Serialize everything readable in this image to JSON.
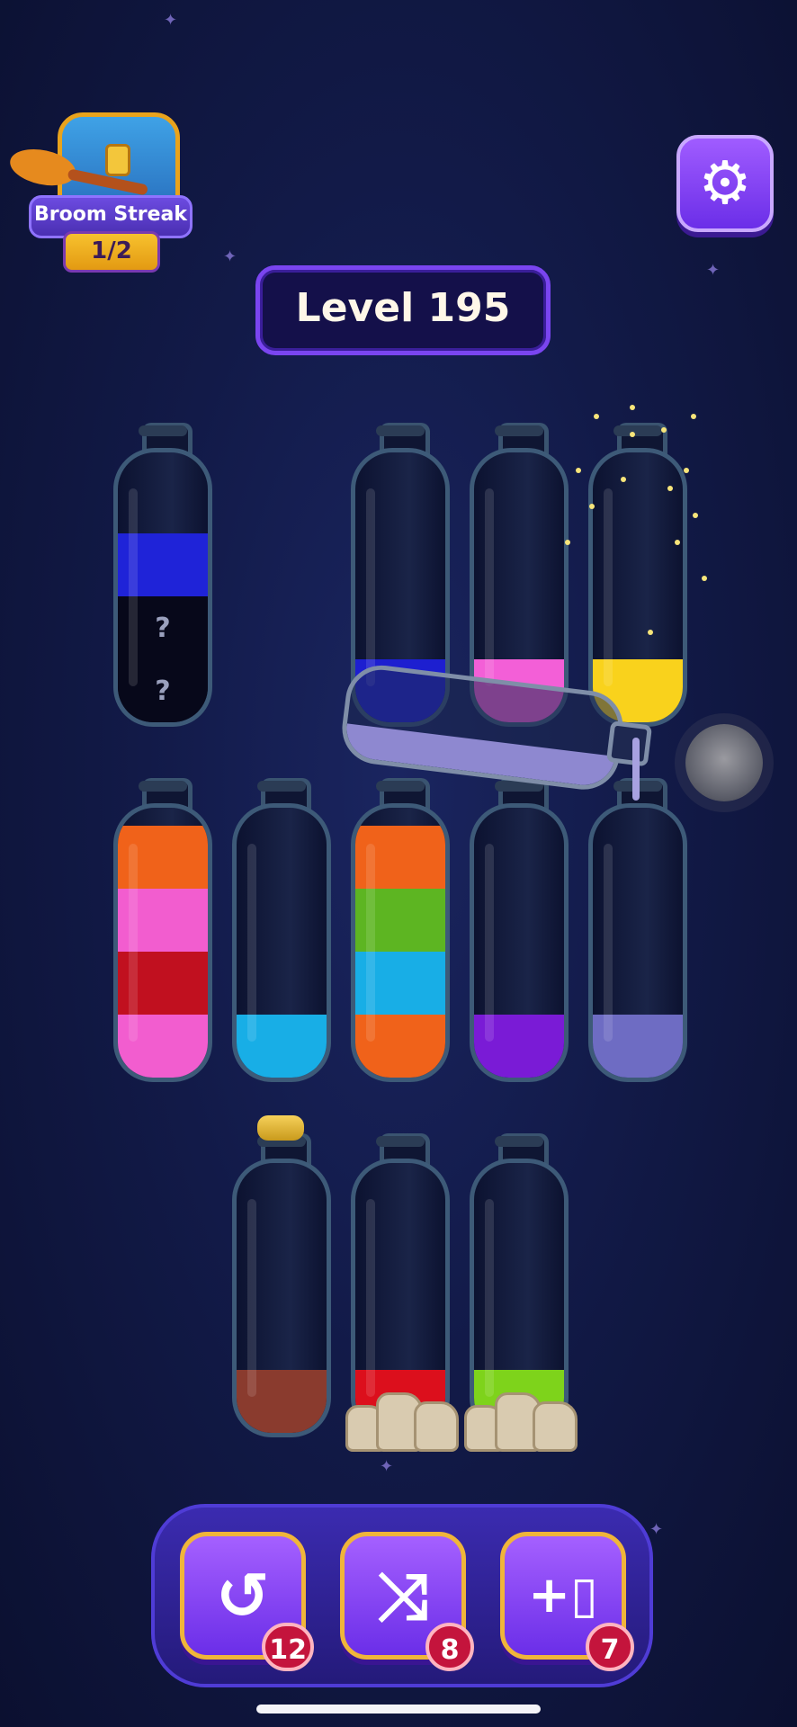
{
  "streak": {
    "title": "Broom Streak",
    "progress": "1/2"
  },
  "level": {
    "label": "Level 195"
  },
  "bottles": [
    {
      "id": "b1",
      "layers": [
        "#1f23d8",
        "hidden",
        "hidden"
      ],
      "hidden_mark": "?"
    },
    {
      "id": "b2",
      "layers": [
        "#1d1fd0"
      ]
    },
    {
      "id": "b3",
      "layers": [
        "#f35fd7"
      ]
    },
    {
      "id": "b4",
      "layers": [
        "#f9d21c"
      ]
    },
    {
      "id": "b5",
      "layers": [
        "#f0621a",
        "#f25dcf",
        "#c1101f",
        "#f25dcf"
      ]
    },
    {
      "id": "b6",
      "layers": [
        "#18aee6"
      ]
    },
    {
      "id": "b7",
      "layers": [
        "#f0621a",
        "#5db522",
        "#18aee6",
        "#f0621a"
      ]
    },
    {
      "id": "b8",
      "layers": [
        "#7a1bd6"
      ]
    },
    {
      "id": "b9",
      "layers": [
        "#6e6cc3"
      ]
    },
    {
      "id": "b10",
      "layers": [
        "#8a3b2e"
      ],
      "corked": true
    },
    {
      "id": "b11",
      "layers": [
        "#dc0f1c"
      ],
      "rocks": true
    },
    {
      "id": "b12",
      "layers": [
        "#7ed31b"
      ],
      "rocks": true
    }
  ],
  "pouring_color": "#8e88d0",
  "tools": [
    {
      "icon": "undo-icon",
      "glyph": "↺",
      "count": "12"
    },
    {
      "icon": "shuffle-icon",
      "glyph": "⤨",
      "count": "8"
    },
    {
      "icon": "add-bottle-icon",
      "glyph": "+▯",
      "count": "7"
    }
  ]
}
